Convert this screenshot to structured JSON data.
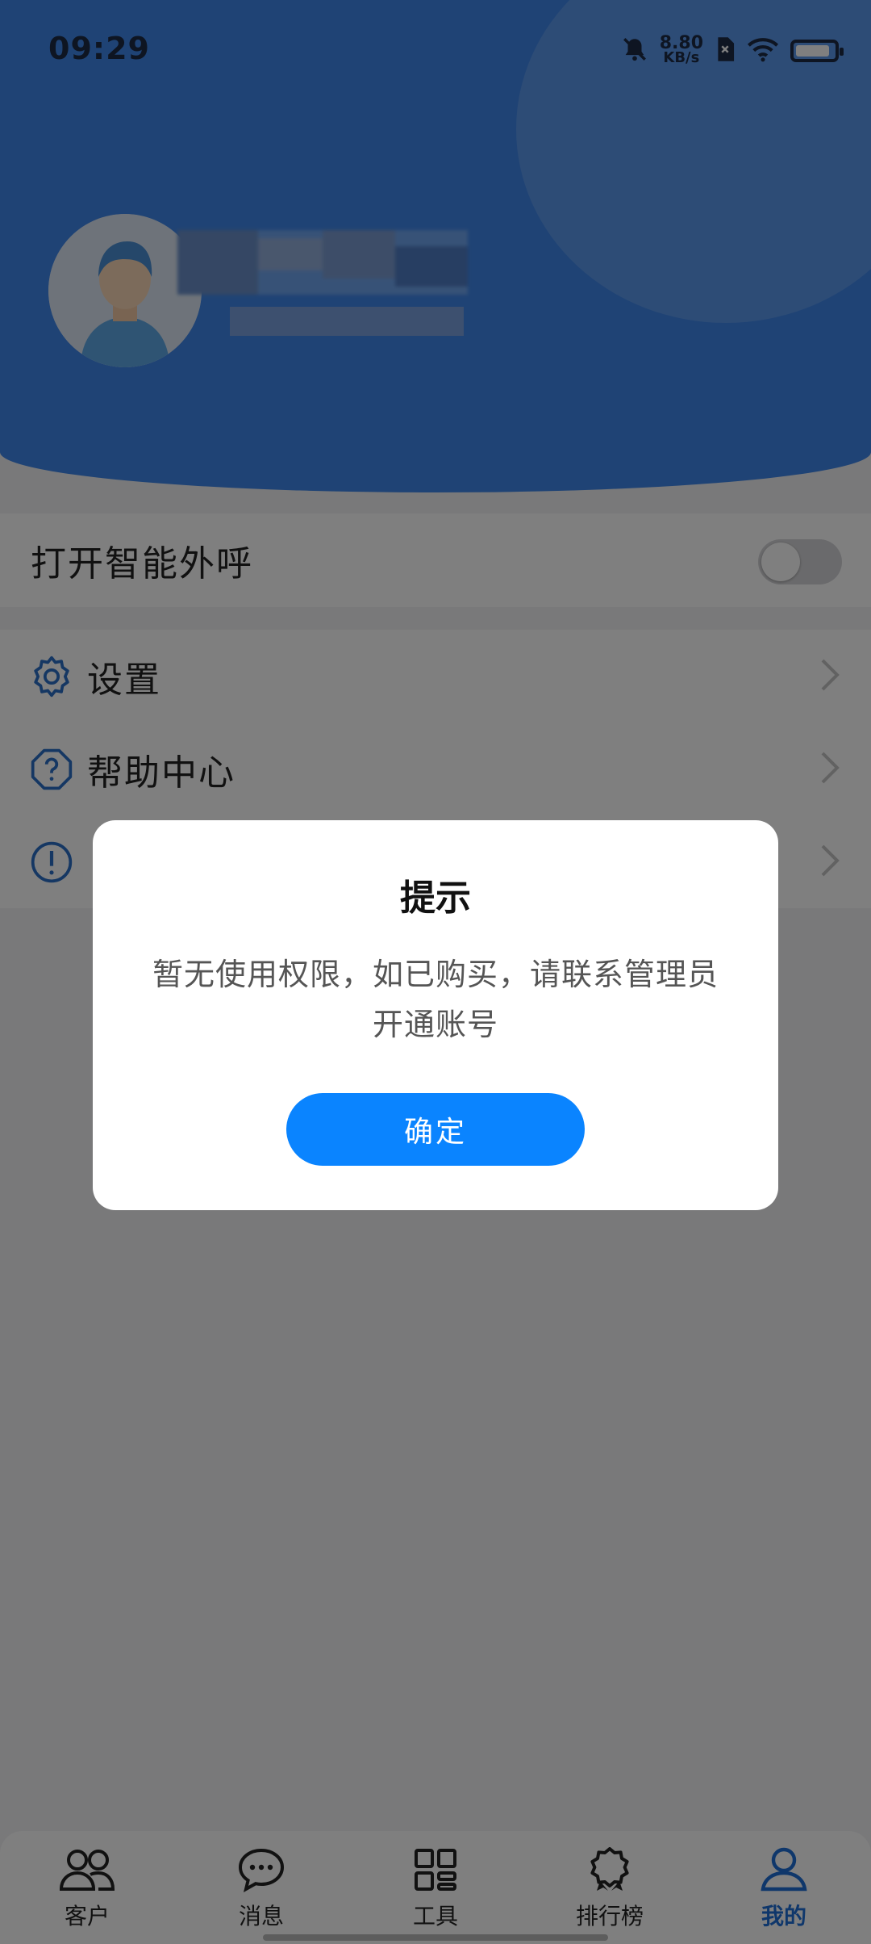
{
  "status_bar": {
    "time": "09:29",
    "net_speed_value": "8.80",
    "net_speed_unit": "KB/s",
    "battery_level": 0.9
  },
  "profile": {
    "avatar": "user-avatar"
  },
  "settings": {
    "toggle_label": "打开智能外呼",
    "toggle_on": false,
    "menu": [
      {
        "label": "设置",
        "icon": "gear-icon"
      },
      {
        "label": "帮助中心",
        "icon": "question-icon"
      },
      {
        "label": "",
        "icon": "info-icon"
      }
    ]
  },
  "dialog": {
    "title": "提示",
    "message": "暂无使用权限，如已购买，请联系管理员开通账号",
    "confirm_label": "确定"
  },
  "tabbar": {
    "tabs": [
      {
        "label": "客户",
        "icon": "customers-icon"
      },
      {
        "label": "消息",
        "icon": "message-icon"
      },
      {
        "label": "工具",
        "icon": "tools-icon"
      },
      {
        "label": "排行榜",
        "icon": "ranking-icon"
      },
      {
        "label": "我的",
        "icon": "profile-icon"
      }
    ],
    "active_tab": "我的"
  },
  "colors": {
    "header": "#3f87ea",
    "accent": "#0a84ff",
    "active_tab": "#1f6fd6",
    "icon_blue": "#2a6fc6"
  }
}
